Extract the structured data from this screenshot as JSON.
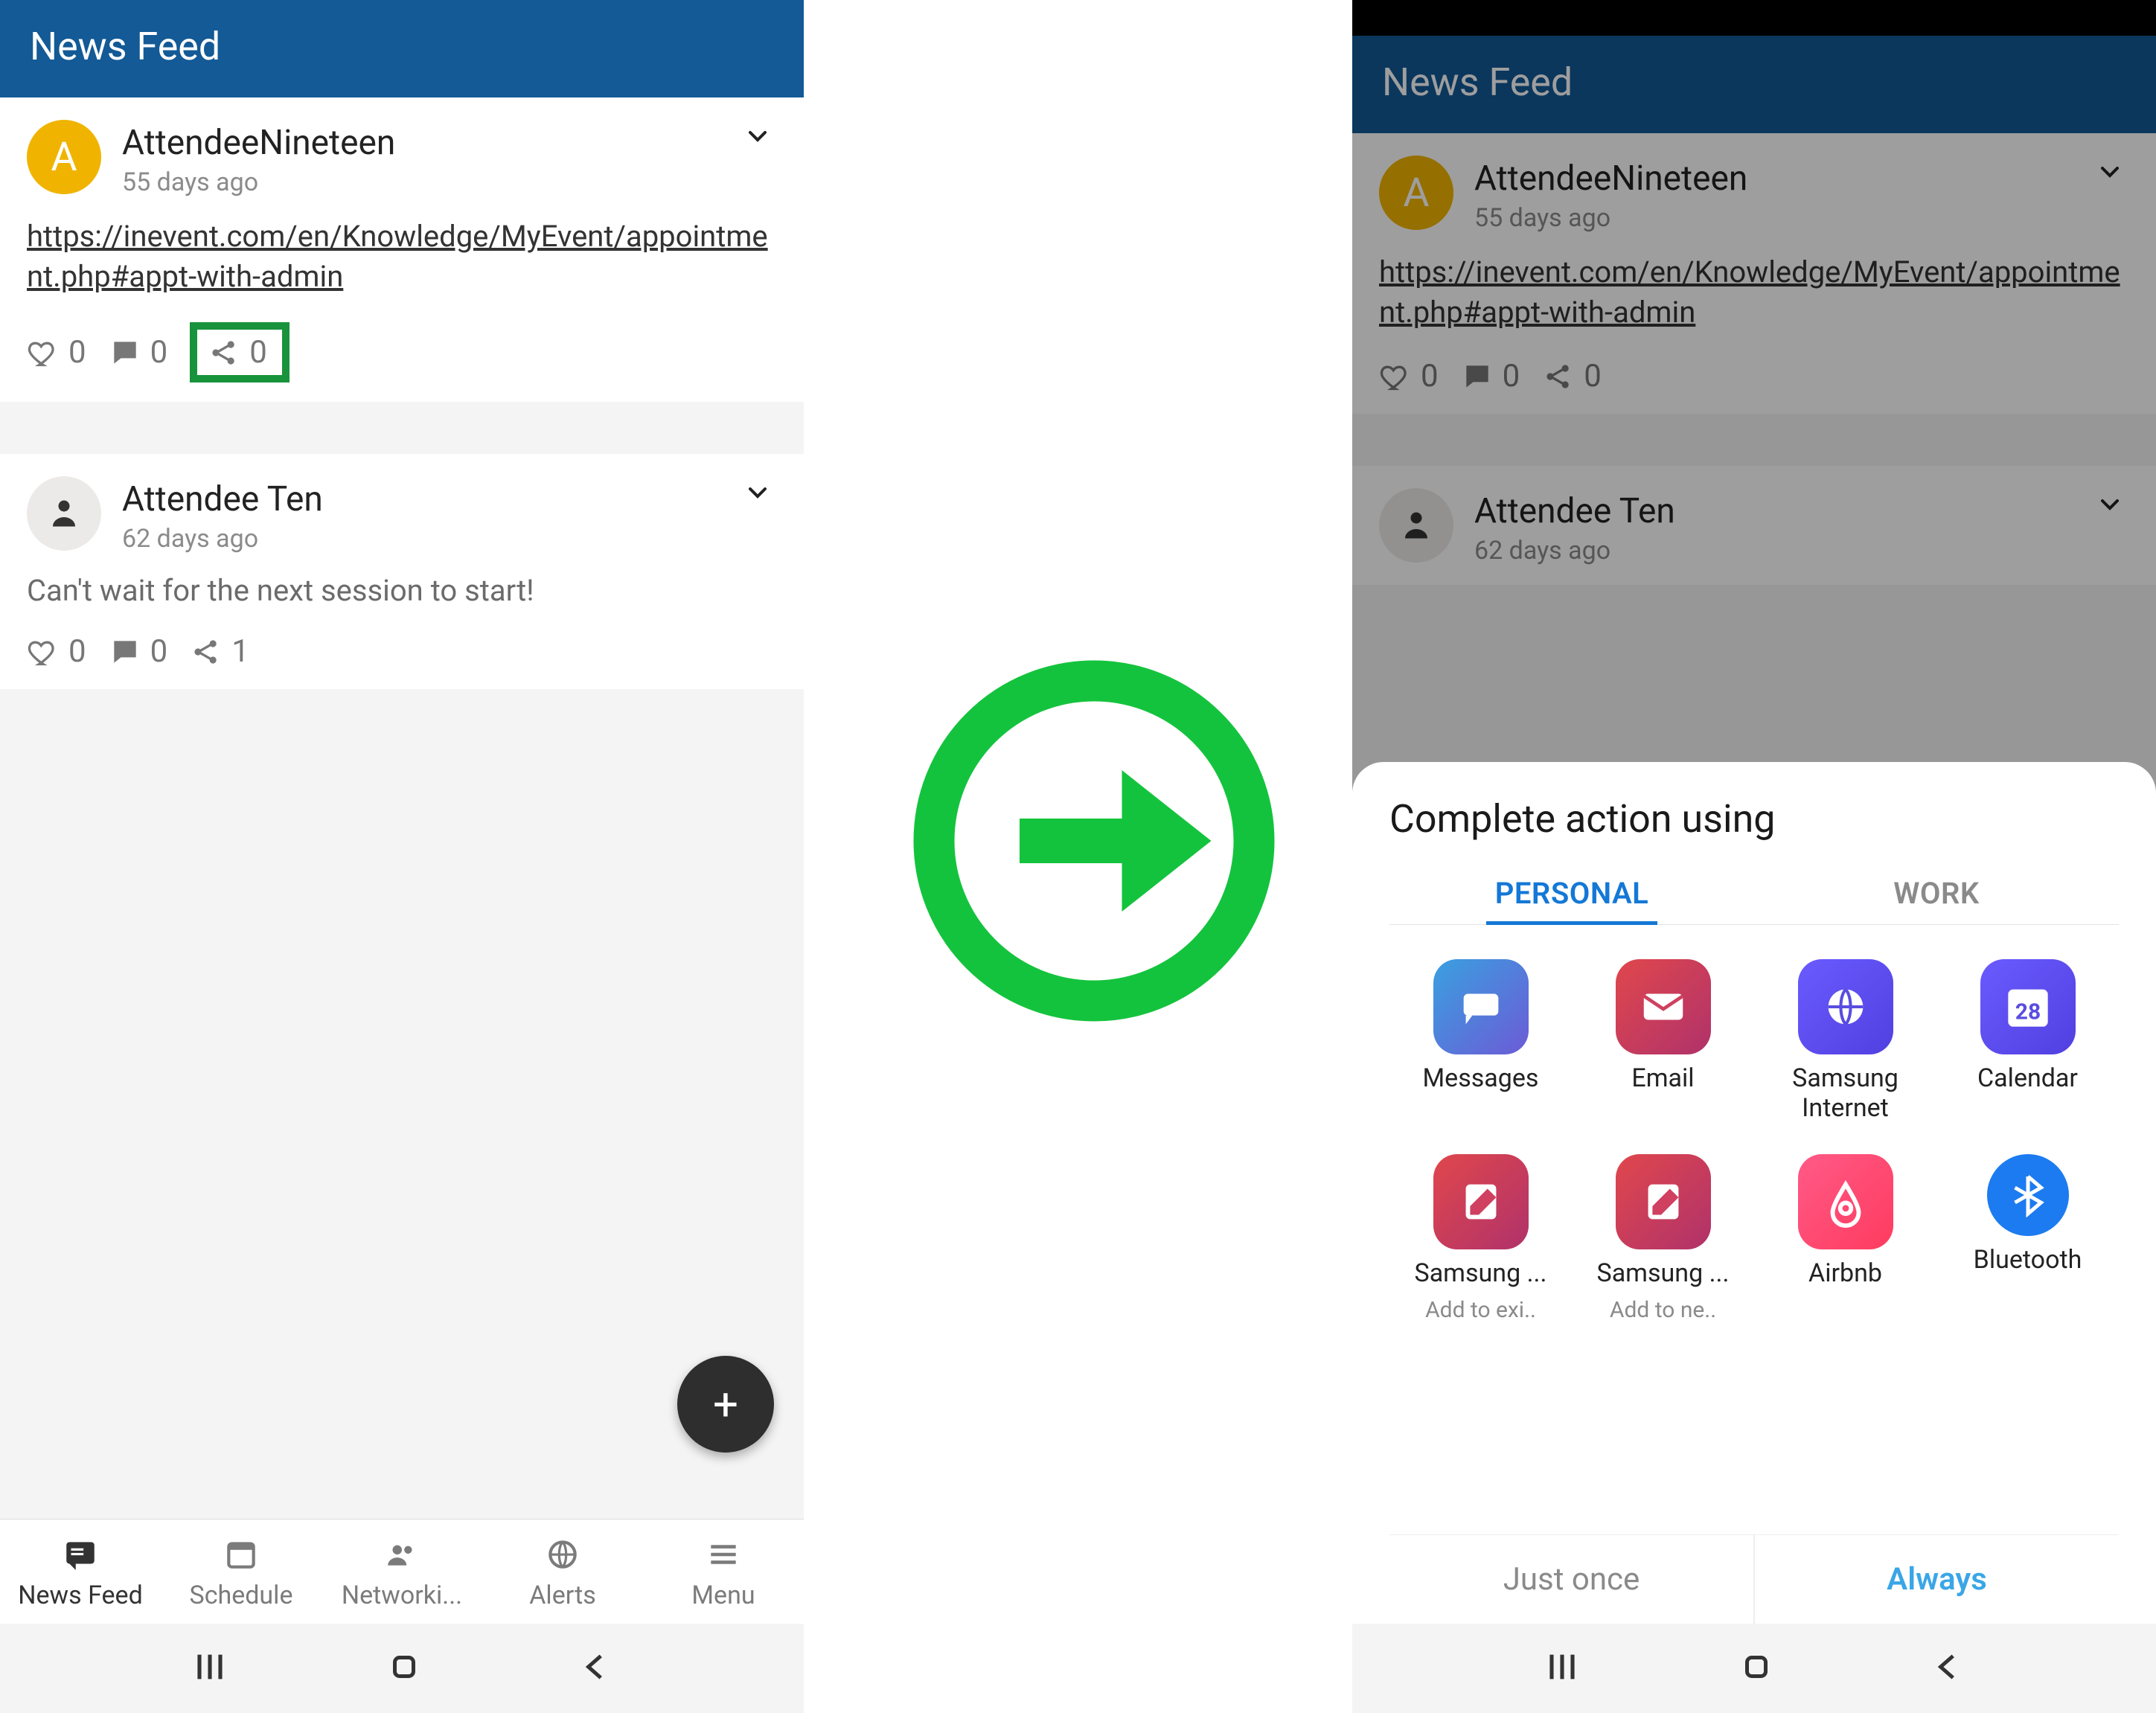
{
  "header": {
    "title": "News Feed"
  },
  "posts": [
    {
      "avatar_letter": "A",
      "author": "AttendeeNineteen",
      "time": "55 days ago",
      "link": "https://inevent.com/en/Knowledge/MyEvent/appointment.php#appt-with-admin",
      "likes": "0",
      "comments": "0",
      "shares": "0"
    },
    {
      "author": "Attendee Ten",
      "time": "62 days ago",
      "text": "Can't wait for the next session to start!",
      "likes": "0",
      "comments": "0",
      "shares": "1"
    }
  ],
  "fab": {
    "label": "+"
  },
  "bottom_tabs": {
    "items": [
      {
        "label": "News Feed"
      },
      {
        "label": "Schedule"
      },
      {
        "label": "Networki..."
      },
      {
        "label": "Alerts"
      },
      {
        "label": "Menu"
      }
    ]
  },
  "share_sheet": {
    "title": "Complete action using",
    "tabs": {
      "personal": "PERSONAL",
      "work": "WORK"
    },
    "apps": [
      {
        "label": "Messages"
      },
      {
        "label": "Email"
      },
      {
        "label": "Samsung Internet"
      },
      {
        "label": "Calendar",
        "badge": "28"
      },
      {
        "label": "Samsung ...",
        "sublabel": "Add to exi.."
      },
      {
        "label": "Samsung ...",
        "sublabel": "Add to ne.."
      },
      {
        "label": "Airbnb"
      },
      {
        "label": "Bluetooth"
      }
    ],
    "buttons": {
      "once": "Just once",
      "always": "Always"
    }
  }
}
